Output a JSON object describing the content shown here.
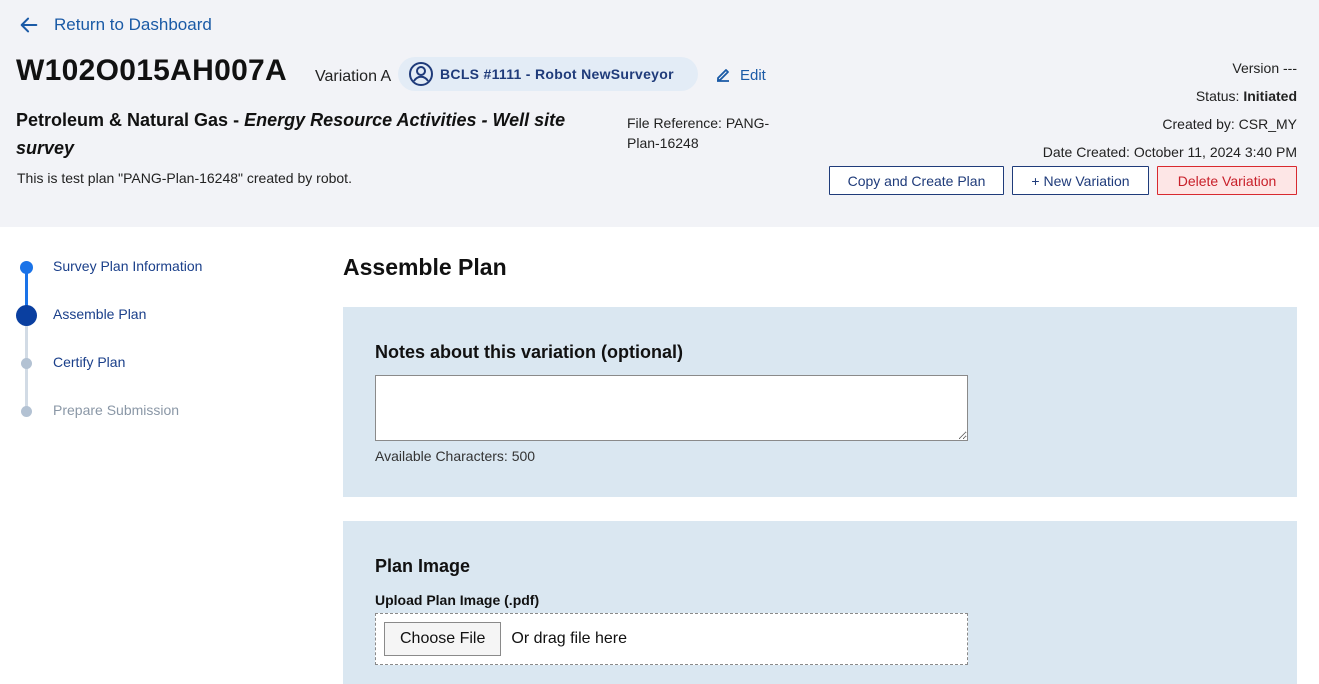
{
  "header": {
    "back_link": "Return to Dashboard",
    "plan_id": "W102O015AH007A",
    "variation": "Variation A",
    "surveyor": "BCLS #1111 - Robot NewSurveyor",
    "edit": "Edit",
    "plan_type_prefix": "Petroleum & Natural Gas - ",
    "plan_type_italic": "Energy Resource Activities - Well site survey",
    "description": "This is test plan \"PANG-Plan-16248\" created by robot.",
    "file_reference": "File Reference: PANG-Plan-16248",
    "version_label": "Version",
    "version_value": "---",
    "status_label": "Status:",
    "status_value": "Initiated",
    "created_by": "Created by: CSR_MY",
    "date_created": "Date Created: October 11, 2024 3:40 PM",
    "buttons": {
      "copy": "Copy and Create Plan",
      "new_variation": "+ New Variation",
      "delete": "Delete Variation"
    }
  },
  "stepper": {
    "steps": [
      {
        "label": "Survey Plan Information",
        "state": "completed"
      },
      {
        "label": "Assemble Plan",
        "state": "current"
      },
      {
        "label": "Certify Plan",
        "state": "upcoming"
      },
      {
        "label": "Prepare Submission",
        "state": "disabled"
      }
    ]
  },
  "main": {
    "title": "Assemble Plan",
    "notes": {
      "title": "Notes about this variation (optional)",
      "value": "",
      "available": "Available Characters: 500"
    },
    "plan_image": {
      "title": "Plan Image",
      "upload_label": "Upload Plan Image (.pdf)",
      "choose_file": "Choose File",
      "drag_text": "Or drag file here"
    }
  },
  "colors": {
    "header_bg": "#f2f3f7",
    "link_blue": "#1a5aa6",
    "navy": "#1f3b7a",
    "panel_bg": "#dae7f1",
    "danger": "#d8292f",
    "step_active": "#0a3fa0",
    "step_done": "#1a73e8",
    "step_inactive": "#a9b9cc"
  }
}
